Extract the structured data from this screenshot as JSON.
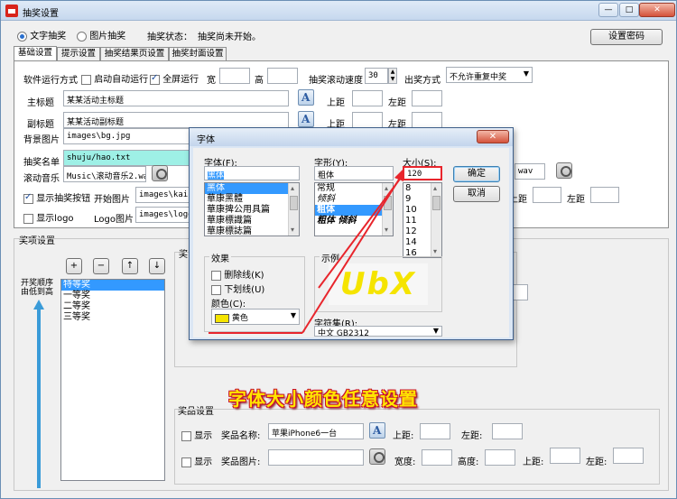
{
  "window": {
    "title": "抽奖设置",
    "buttons": {
      "minimize": "—",
      "maximize": "□",
      "close": "✕"
    }
  },
  "top": {
    "mode_text": "文字抽奖",
    "mode_image": "图片抽奖",
    "status_label": "抽奖状态：",
    "status_value": "抽奖尚未开始。",
    "set_password": "设置密码"
  },
  "tabs": [
    "基础设置",
    "提示设置",
    "抽奖结果页设置",
    "抽奖封面设置"
  ],
  "basic": {
    "run_mode_label": "软件运行方式",
    "auto_run": "启动自动运行",
    "fullscreen": "全屏运行",
    "width_label": "宽",
    "height_label": "高",
    "scroll_speed_label": "抽奖滚动速度",
    "scroll_speed_value": "30",
    "output_mode_label": "出奖方式",
    "output_mode_value": "不允许重复中奖",
    "main_title_label": "主标题",
    "main_title_value": "某某活动主标题",
    "sub_title_label": "副标题",
    "sub_title_value": "某某活动副标题",
    "top_margin_label": "上距",
    "left_margin_label": "左距",
    "bg_image_label": "背景图片",
    "bg_image_value": "images\\bg.jpg",
    "list_label": "抽奖名单",
    "list_value": "shuju/hao.txt",
    "music_label": "滚动音乐",
    "music_value": "Music\\滚动音乐2.wav",
    "music_right_value": "wav",
    "show_button": "显示抽奖按钮",
    "start_image_label": "开始图片",
    "start_image_value": "images\\kaishi",
    "show_logo": "显示logo",
    "logo_image_label": "Logo图片",
    "logo_image_value": "images\\logo.p"
  },
  "prize_section": {
    "title": "奖项设置",
    "add": "+",
    "remove": "−",
    "up": "↑",
    "down": "↓",
    "order_label": "开奖顺序由低到高",
    "prizes": [
      "特等奖",
      "一等奖",
      "二等奖",
      "三等奖"
    ],
    "side_fragment": "奖"
  },
  "goods": {
    "title": "奖品设置",
    "show1": "显示",
    "name_label": "奖品名称:",
    "name_value": "苹果iPhone6一台",
    "top_label": "上距:",
    "left_label": "左距:",
    "show2": "显示",
    "image_label": "奖品图片:",
    "width_label": "宽度:",
    "height_label": "高度:",
    "top_label2": "上距:",
    "left_label2": "左距:"
  },
  "font_dialog": {
    "title": "字体",
    "close": "✕",
    "font_label": "字体(F):",
    "font_value": "黑体",
    "fonts": [
      "黑体",
      "華康黑體",
      "華康捭公用具篇",
      "華康標識篇",
      "華康標誌篇"
    ],
    "style_label": "字形(Y):",
    "style_value": "粗体",
    "styles": [
      "常规",
      "倾斜",
      "粗体",
      "粗体 倾斜"
    ],
    "size_label": "大小(S):",
    "size_value": "120",
    "sizes": [
      "8",
      "9",
      "10",
      "11",
      "12",
      "14",
      "16"
    ],
    "ok": "确定",
    "cancel": "取消",
    "effects_label": "效果",
    "strikeout": "删除线(K)",
    "underline": "下划线(U)",
    "color_label": "颜色(C):",
    "color_value": "黄色",
    "color_swatch": "#f5e400",
    "sample_label": "示例",
    "sample_text": "UbX",
    "charset_label": "字符集(R):",
    "charset_value": "中文 GB2312"
  },
  "annotation": {
    "text": "字体大小颜色任意设置",
    "color": "#ffe600",
    "arrow_color": "#e8252c"
  }
}
